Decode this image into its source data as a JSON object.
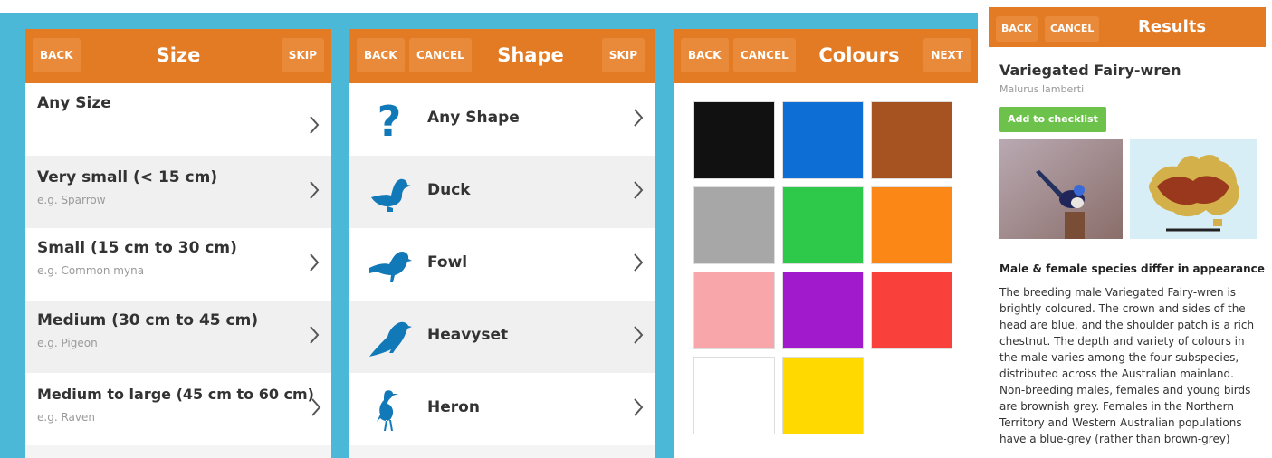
{
  "colors": {
    "accent": "#e27b24",
    "frame": "#4ab8d6",
    "shape_icon": "#1279b8",
    "add_button": "#6cc24a"
  },
  "size_screen": {
    "back_label": "BACK",
    "title": "Size",
    "skip_label": "SKIP",
    "items": [
      {
        "label": "Any Size",
        "example": ""
      },
      {
        "label": "Very small (< 15 cm)",
        "example": "e.g. Sparrow"
      },
      {
        "label": "Small (15 cm to 30 cm)",
        "example": "e.g. Common myna"
      },
      {
        "label": "Medium (30 cm to 45 cm)",
        "example": "e.g. Pigeon"
      },
      {
        "label": "Medium to large (45 cm to 60 cm)",
        "example": "e.g. Raven"
      }
    ]
  },
  "shape_screen": {
    "back_label": "BACK",
    "cancel_label": "CANCEL",
    "title": "Shape",
    "skip_label": "SKIP",
    "items": [
      {
        "label": "Any Shape",
        "icon": "question-icon"
      },
      {
        "label": "Duck",
        "icon": "duck-icon"
      },
      {
        "label": "Fowl",
        "icon": "fowl-icon"
      },
      {
        "label": "Heavyset",
        "icon": "heavyset-icon"
      },
      {
        "label": "Heron",
        "icon": "heron-icon"
      }
    ]
  },
  "colour_screen": {
    "back_label": "BACK",
    "cancel_label": "CANCEL",
    "title": "Colours",
    "next_label": "NEXT",
    "swatches": [
      "#111111",
      "#0d6fd6",
      "#a65321",
      "#a7a7a7",
      "#2ec94a",
      "#fb8716",
      "#f9a6aa",
      "#a11bcd",
      "#f9403b",
      "#ffffff",
      "#ffd900"
    ]
  },
  "results_screen": {
    "back_label": "BACK",
    "cancel_label": "CANCEL",
    "title": "Results",
    "species_name": "Variegated Fairy-wren",
    "scientific_name": "Malurus lamberti",
    "add_button_label": "Add to checklist",
    "section_heading": "Male & female species differ in appearance",
    "description": "The breeding male Variegated Fairy-wren is brightly coloured. The crown and sides of the head are blue, and the shoulder patch is a rich chestnut. The depth and variety of colours in the male varies among the four subspecies, distributed across the Australian mainland. Non-breeding males, females and young birds are brownish grey. Females in the Northern Territory and Western Australian populations have a blue-grey (rather than brown-grey)"
  }
}
